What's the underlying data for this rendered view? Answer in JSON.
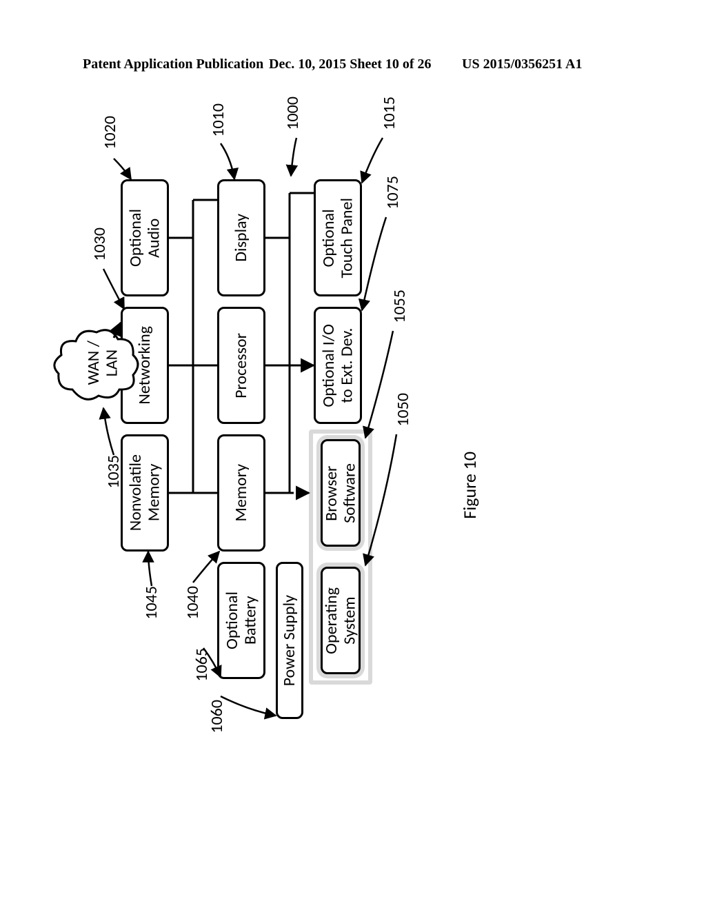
{
  "header": {
    "left": "Patent Application Publication",
    "mid": "Dec. 10, 2015  Sheet 10 of 26",
    "right": "US 2015/0356251 A1"
  },
  "figure_caption": "Figure 10",
  "refs": {
    "r1000": "1000",
    "r1010": "1010",
    "r1015": "1015",
    "r1020": "1020",
    "r1030": "1030",
    "r1035": "1035",
    "r1040": "1040",
    "r1045": "1045",
    "r1050": "1050",
    "r1055": "1055",
    "r1060": "1060",
    "r1065": "1065",
    "r1075": "1075"
  },
  "boxes": {
    "touch_panel": "Optional\nTouch Panel",
    "optional_io": "Optional I/O\nto Ext. Dev.",
    "browser": "Browser\nSoftware",
    "os": "Operating\nSystem",
    "display": "Display",
    "processor": "Processor",
    "memory": "Memory",
    "battery": "Optional\nBattery",
    "power": "Power Supply",
    "audio": "Optional\nAudio",
    "networking": "Networking",
    "nvmem": "Nonvolatile\nMemory",
    "wanlan": "WAN /\nLAN"
  }
}
